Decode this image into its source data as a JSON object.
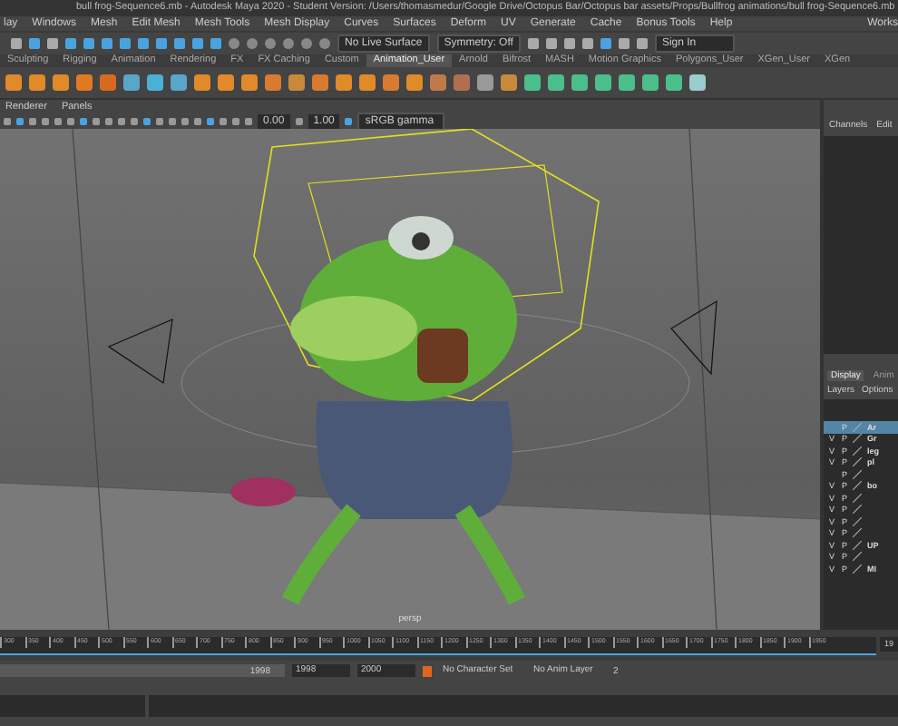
{
  "window": {
    "title": "bull frog-Sequence6.mb - Autodesk Maya 2020 - Student Version: /Users/thomasmedur/Google Drive/Octopus Bar/Octopus bar assets/Props/Bullfrog animations/bull frog-Sequence6.mb"
  },
  "menu_bar": {
    "items": [
      "lay",
      "Windows",
      "Mesh",
      "Edit Mesh",
      "Mesh Tools",
      "Mesh Display",
      "Curves",
      "Surfaces",
      "Deform",
      "UV",
      "Generate",
      "Cache",
      "Bonus Tools",
      "Help"
    ],
    "workspace": "Works"
  },
  "status_line": {
    "live_surface": "No Live Surface",
    "symmetry": "Symmetry: Off",
    "sign_in": "Sign In"
  },
  "shelf_tabs": [
    {
      "label": "Sculpting",
      "selected": false
    },
    {
      "label": "Rigging",
      "selected": false
    },
    {
      "label": "Animation",
      "selected": false
    },
    {
      "label": "Rendering",
      "selected": false
    },
    {
      "label": "FX",
      "selected": false
    },
    {
      "label": "FX Caching",
      "selected": false
    },
    {
      "label": "Custom",
      "selected": false
    },
    {
      "label": "Animation_User",
      "selected": true
    },
    {
      "label": "Arnold",
      "selected": false
    },
    {
      "label": "Bifrost",
      "selected": false
    },
    {
      "label": "MASH",
      "selected": false
    },
    {
      "label": "Motion Graphics",
      "selected": false
    },
    {
      "label": "Polygons_User",
      "selected": false
    },
    {
      "label": "XGen_User",
      "selected": false
    },
    {
      "label": "XGen",
      "selected": false
    }
  ],
  "viewport": {
    "menu": [
      "Renderer",
      "Panels"
    ],
    "exposure": "0.00",
    "gamma": "1.00",
    "color_space": "sRGB gamma",
    "camera": "persp"
  },
  "channel_box": {
    "tabs": [
      "Channels",
      "Edit"
    ]
  },
  "layer_editor": {
    "tabs": [
      {
        "label": "Display",
        "selected": true
      },
      {
        "label": "Anim",
        "selected": false
      }
    ],
    "menu": [
      "Layers",
      "Options"
    ],
    "layers": [
      {
        "playback": "P",
        "name": "Ar",
        "selected": true
      },
      {
        "visibility": "V",
        "playback": "P",
        "name": "Gr",
        "selected": false
      },
      {
        "visibility": "V",
        "playback": "P",
        "name": "leg",
        "selected": false
      },
      {
        "visibility": "V",
        "playback": "P",
        "name": "pl",
        "selected": false
      },
      {
        "playback": "P",
        "selected": false
      },
      {
        "visibility": "V",
        "playback": "P",
        "name": "bo",
        "selected": false
      },
      {
        "visibility": "V",
        "playback": "P",
        "selected": false
      },
      {
        "visibility": "V",
        "playback": "P",
        "selected": false
      },
      {
        "visibility": "V",
        "playback": "P",
        "selected": false
      },
      {
        "visibility": "V",
        "playback": "P",
        "selected": false
      },
      {
        "visibility": "V",
        "playback": "P",
        "name": "UP",
        "selected": false
      },
      {
        "visibility": "V",
        "playback": "P",
        "selected": false
      },
      {
        "visibility": "V",
        "playback": "P",
        "name": "MI",
        "selected": false
      }
    ]
  },
  "timeline": {
    "ticks": [
      "300",
      "350",
      "400",
      "450",
      "500",
      "550",
      "600",
      "650",
      "700",
      "750",
      "800",
      "850",
      "900",
      "950",
      "1000",
      "1050",
      "1100",
      "1150",
      "1200",
      "1250",
      "1300",
      "1350",
      "1400",
      "1450",
      "1500",
      "1550",
      "1600",
      "1650",
      "1700",
      "1750",
      "1800",
      "1850",
      "1900",
      "1950"
    ],
    "current_frame": "19",
    "level": 1
  },
  "range_slider": {
    "level": 1,
    "slider_end": "1998",
    "range_end": "1998",
    "animation_end": "2000",
    "character_set": "No Character Set",
    "anim_layer": "No Anim Layer",
    "cut": "2"
  }
}
